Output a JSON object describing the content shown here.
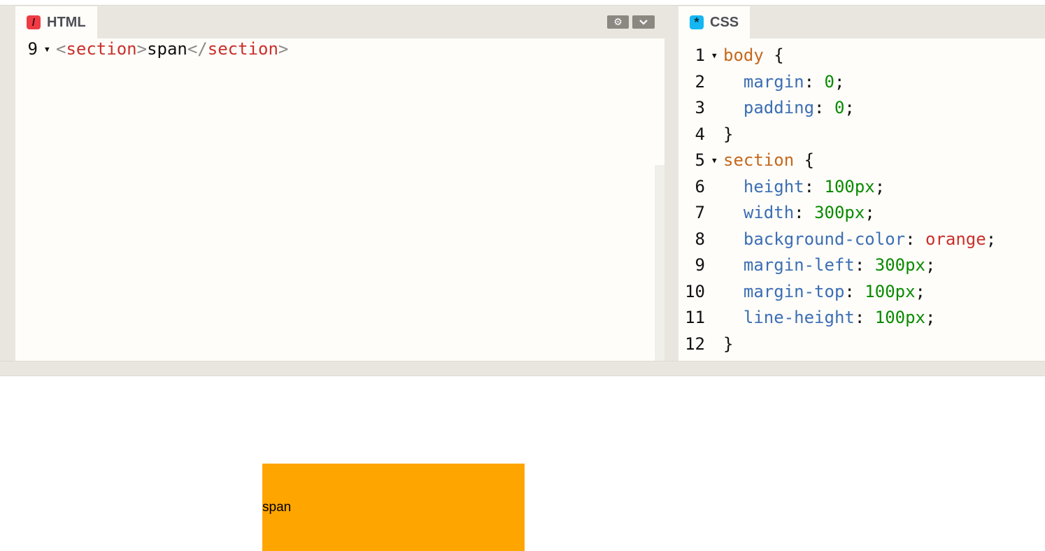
{
  "html_pane": {
    "tab_label": "HTML",
    "tab_icon": "/",
    "gear_icon": "⚙",
    "chevron_icon": "⌄",
    "lines": [
      {
        "number": "9",
        "fold": true,
        "tokens": [
          {
            "text": "<",
            "cls": "t-br"
          },
          {
            "text": "section",
            "cls": "t-tag"
          },
          {
            "text": ">",
            "cls": "t-br"
          },
          {
            "text": "span",
            "cls": "t-pun"
          },
          {
            "text": "</",
            "cls": "t-br"
          },
          {
            "text": "section",
            "cls": "t-tag"
          },
          {
            "text": ">",
            "cls": "t-br"
          }
        ]
      }
    ]
  },
  "css_pane": {
    "tab_label": "CSS",
    "tab_icon": "*",
    "lines": [
      {
        "number": "1",
        "fold": true,
        "tokens": [
          {
            "text": "body",
            "cls": "t-sel"
          },
          {
            "text": " {",
            "cls": "t-pun"
          }
        ]
      },
      {
        "number": "2",
        "fold": false,
        "tokens": [
          {
            "text": "  margin",
            "cls": "t-prop"
          },
          {
            "text": ": ",
            "cls": "t-pun"
          },
          {
            "text": "0",
            "cls": "t-num"
          },
          {
            "text": ";",
            "cls": "t-pun"
          }
        ]
      },
      {
        "number": "3",
        "fold": false,
        "tokens": [
          {
            "text": "  padding",
            "cls": "t-prop"
          },
          {
            "text": ": ",
            "cls": "t-pun"
          },
          {
            "text": "0",
            "cls": "t-num"
          },
          {
            "text": ";",
            "cls": "t-pun"
          }
        ]
      },
      {
        "number": "4",
        "fold": false,
        "tokens": [
          {
            "text": "}",
            "cls": "t-pun"
          }
        ]
      },
      {
        "number": "5",
        "fold": true,
        "tokens": [
          {
            "text": "section",
            "cls": "t-sel"
          },
          {
            "text": " {",
            "cls": "t-pun"
          }
        ]
      },
      {
        "number": "6",
        "fold": false,
        "tokens": [
          {
            "text": "  height",
            "cls": "t-prop"
          },
          {
            "text": ": ",
            "cls": "t-pun"
          },
          {
            "text": "100px",
            "cls": "t-num"
          },
          {
            "text": ";",
            "cls": "t-pun"
          }
        ]
      },
      {
        "number": "7",
        "fold": false,
        "tokens": [
          {
            "text": "  width",
            "cls": "t-prop"
          },
          {
            "text": ": ",
            "cls": "t-pun"
          },
          {
            "text": "300px",
            "cls": "t-num"
          },
          {
            "text": ";",
            "cls": "t-pun"
          }
        ]
      },
      {
        "number": "8",
        "fold": false,
        "tokens": [
          {
            "text": "  background-color",
            "cls": "t-prop"
          },
          {
            "text": ": ",
            "cls": "t-pun"
          },
          {
            "text": "orange",
            "cls": "t-kw"
          },
          {
            "text": ";",
            "cls": "t-pun"
          }
        ]
      },
      {
        "number": "9",
        "fold": false,
        "tokens": [
          {
            "text": "  margin-left",
            "cls": "t-prop"
          },
          {
            "text": ": ",
            "cls": "t-pun"
          },
          {
            "text": "300px",
            "cls": "t-num"
          },
          {
            "text": ";",
            "cls": "t-pun"
          }
        ]
      },
      {
        "number": "10",
        "fold": false,
        "tokens": [
          {
            "text": "  margin-top",
            "cls": "t-prop"
          },
          {
            "text": ": ",
            "cls": "t-pun"
          },
          {
            "text": "100px",
            "cls": "t-num"
          },
          {
            "text": ";",
            "cls": "t-pun"
          }
        ]
      },
      {
        "number": "11",
        "fold": false,
        "tokens": [
          {
            "text": "  line-height",
            "cls": "t-prop"
          },
          {
            "text": ": ",
            "cls": "t-pun"
          },
          {
            "text": "100px",
            "cls": "t-num"
          },
          {
            "text": ";",
            "cls": "t-pun"
          }
        ]
      },
      {
        "number": "12",
        "fold": false,
        "tokens": [
          {
            "text": "}",
            "cls": "t-pun"
          }
        ]
      }
    ]
  },
  "preview": {
    "section_text": "span",
    "section_color": "#FFA500"
  },
  "colors": {
    "chrome": "#e8e6de",
    "editor_bg": "#fefdf9",
    "html_icon": "#ee3b44",
    "css_icon": "#15b6f1"
  }
}
